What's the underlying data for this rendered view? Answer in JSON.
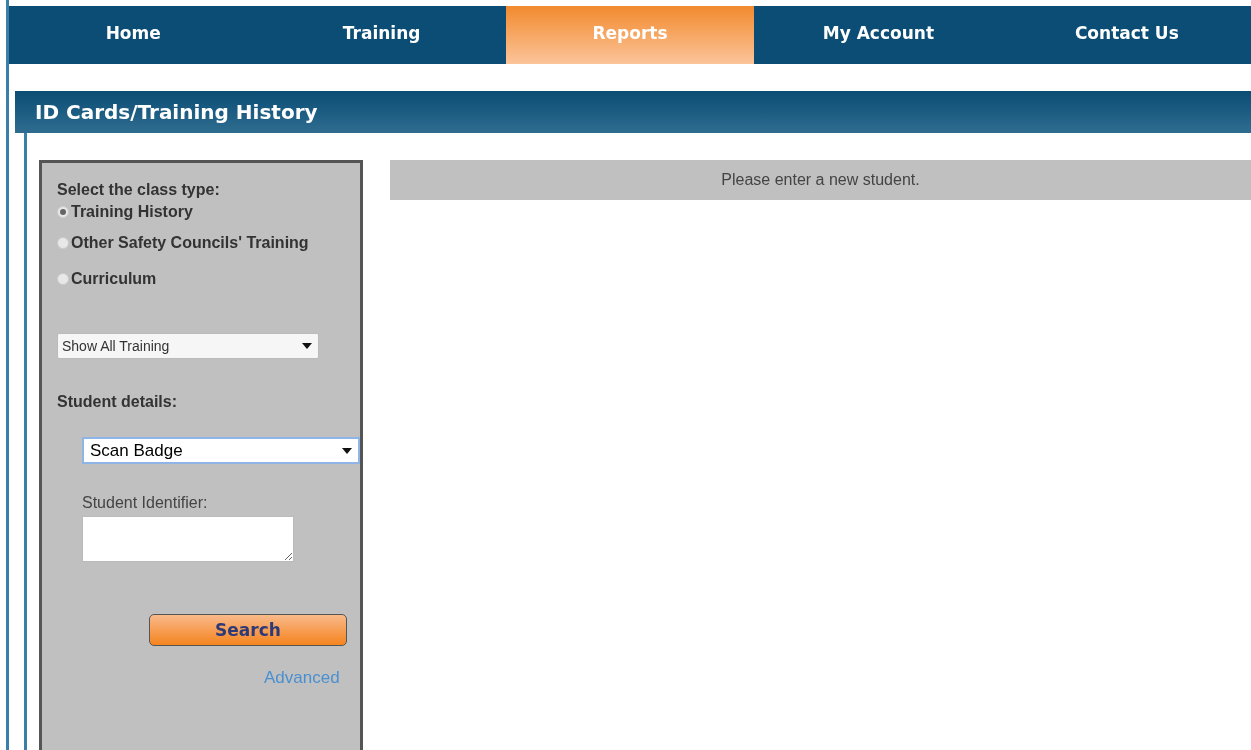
{
  "nav": [
    {
      "label": "Home",
      "selected": false
    },
    {
      "label": "Training",
      "selected": false
    },
    {
      "label": "Reports",
      "selected": true
    },
    {
      "label": "My Account",
      "selected": false
    },
    {
      "label": "Contact Us",
      "selected": false
    }
  ],
  "section": {
    "title": "ID Cards/Training History"
  },
  "panel": {
    "class_type_label": "Select the class type:",
    "class_types": [
      {
        "label": "Training History",
        "selected": true
      },
      {
        "label": "Other Safety Councils' Training",
        "selected": false
      },
      {
        "label": "Curriculum",
        "selected": false
      }
    ],
    "filter": {
      "value": "Show All Training"
    },
    "student_label": "Student details:",
    "lookup": {
      "value": "Scan Badge"
    },
    "identifier_label": "Student Identifier:",
    "search_button": "Search",
    "advanced_link": "Advanced"
  },
  "message": "Please enter a new student."
}
